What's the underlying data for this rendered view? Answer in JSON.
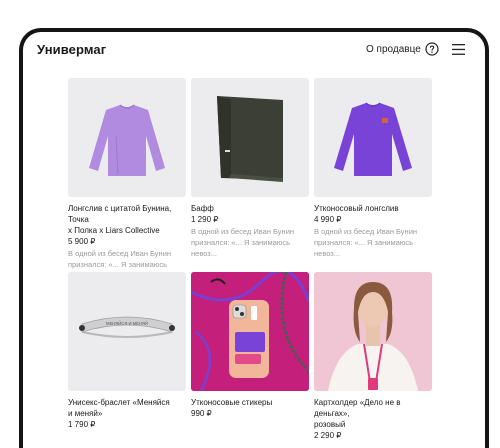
{
  "header": {
    "brand": "Универмаг",
    "about_link": "О продавце",
    "help_icon": "question-circle-icon",
    "menu_icon": "hamburger-menu-icon"
  },
  "products": [
    {
      "title_line1": "Лонгслив с цитатой Бунина, Точка",
      "title_line2": "х Полка х Liars Collective",
      "price": "5 900 ₽",
      "desc_line1": "В одной из бесед Иван Бунин",
      "desc_line2": "признался: «... Я занимаюсь невоз..."
    },
    {
      "title_line1": "Бафф",
      "title_line2": "",
      "price": "1 290 ₽",
      "desc_line1": "В одной из бесед Иван Бунин",
      "desc_line2": "признался: «... Я занимаюсь невоз..."
    },
    {
      "title_line1": "Утконосовый лонгслив",
      "title_line2": "",
      "price": "4 990 ₽",
      "desc_line1": "В одной из бесед Иван Бунин",
      "desc_line2": "признался: «... Я занимаюсь невоз..."
    },
    {
      "title_line1": "Унисекс-браслет «Меняйся",
      "title_line2": "и меняй»",
      "price": "1 790 ₽",
      "bracelet_engraving": "МЕНЯЙСЯ И МЕНЯЙ"
    },
    {
      "title_line1": "Утконосовые стикеры",
      "title_line2": "",
      "price": "990 ₽"
    },
    {
      "title_line1": "Картхолдер «Дело не в деньгах»,",
      "title_line2": "розовый",
      "price": "2 290 ₽"
    }
  ],
  "colors": {
    "lavender_shirt": "#b08be0",
    "buff": "#3b3f35",
    "purple_shirt": "#7a43d8",
    "stickers_bg": "#c41f7a",
    "cardholder_bg": "#f1c6d4"
  }
}
